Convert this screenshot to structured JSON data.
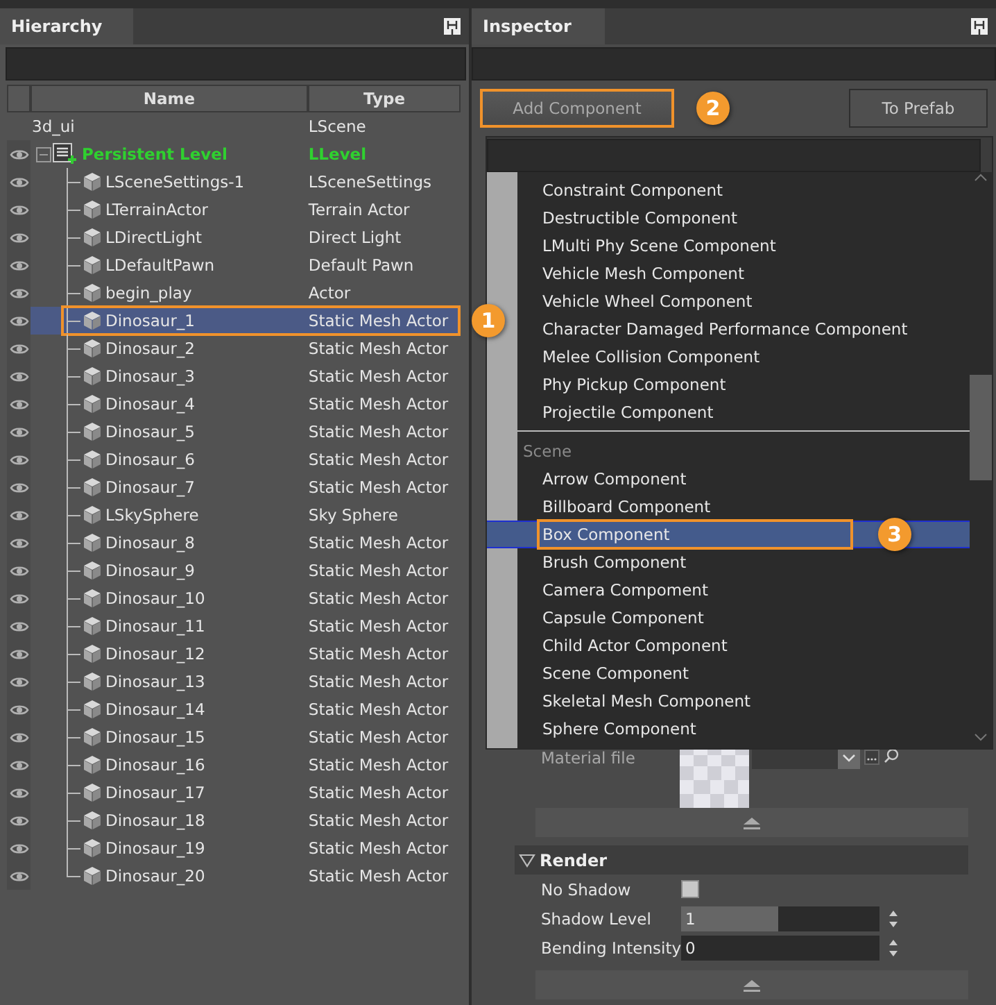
{
  "hierarchy": {
    "tab": "Hierarchy",
    "columns": [
      "Name",
      "Type"
    ],
    "root": {
      "name": "3d_ui",
      "type": "LScene",
      "selected": false,
      "children": [
        {
          "name": "Persistent Level",
          "type": "LLevel",
          "kind": "level",
          "visible": true,
          "expanded": true,
          "selected": false,
          "children": [
            {
              "name": "LSceneSettings-1",
              "type": "LSceneSettings",
              "kind": "actor",
              "visible": true,
              "selected": false
            },
            {
              "name": "LTerrainActor",
              "type": "Terrain Actor",
              "kind": "actor",
              "visible": true,
              "selected": false
            },
            {
              "name": "LDirectLight",
              "type": "Direct Light",
              "kind": "actor",
              "visible": true,
              "selected": false
            },
            {
              "name": "LDefaultPawn",
              "type": "Default Pawn",
              "kind": "actor",
              "visible": true,
              "selected": false
            },
            {
              "name": "begin_play",
              "type": "Actor",
              "kind": "actor",
              "visible": true,
              "selected": false
            },
            {
              "name": "Dinosaur_1",
              "type": "Static Mesh Actor",
              "kind": "actor",
              "visible": true,
              "selected": true,
              "callout": "1"
            },
            {
              "name": "Dinosaur_2",
              "type": "Static Mesh Actor",
              "kind": "actor",
              "visible": true,
              "selected": false
            },
            {
              "name": "Dinosaur_3",
              "type": "Static Mesh Actor",
              "kind": "actor",
              "visible": true,
              "selected": false
            },
            {
              "name": "Dinosaur_4",
              "type": "Static Mesh Actor",
              "kind": "actor",
              "visible": true,
              "selected": false
            },
            {
              "name": "Dinosaur_5",
              "type": "Static Mesh Actor",
              "kind": "actor",
              "visible": true,
              "selected": false
            },
            {
              "name": "Dinosaur_6",
              "type": "Static Mesh Actor",
              "kind": "actor",
              "visible": true,
              "selected": false
            },
            {
              "name": "Dinosaur_7",
              "type": "Static Mesh Actor",
              "kind": "actor",
              "visible": true,
              "selected": false
            },
            {
              "name": "LSkySphere",
              "type": "Sky Sphere",
              "kind": "actor",
              "visible": true,
              "selected": false
            },
            {
              "name": "Dinosaur_8",
              "type": "Static Mesh Actor",
              "kind": "actor",
              "visible": true,
              "selected": false
            },
            {
              "name": "Dinosaur_9",
              "type": "Static Mesh Actor",
              "kind": "actor",
              "visible": true,
              "selected": false
            },
            {
              "name": "Dinosaur_10",
              "type": "Static Mesh Actor",
              "kind": "actor",
              "visible": true,
              "selected": false
            },
            {
              "name": "Dinosaur_11",
              "type": "Static Mesh Actor",
              "kind": "actor",
              "visible": true,
              "selected": false
            },
            {
              "name": "Dinosaur_12",
              "type": "Static Mesh Actor",
              "kind": "actor",
              "visible": true,
              "selected": false
            },
            {
              "name": "Dinosaur_13",
              "type": "Static Mesh Actor",
              "kind": "actor",
              "visible": true,
              "selected": false
            },
            {
              "name": "Dinosaur_14",
              "type": "Static Mesh Actor",
              "kind": "actor",
              "visible": true,
              "selected": false
            },
            {
              "name": "Dinosaur_15",
              "type": "Static Mesh Actor",
              "kind": "actor",
              "visible": true,
              "selected": false
            },
            {
              "name": "Dinosaur_16",
              "type": "Static Mesh Actor",
              "kind": "actor",
              "visible": true,
              "selected": false
            },
            {
              "name": "Dinosaur_17",
              "type": "Static Mesh Actor",
              "kind": "actor",
              "visible": true,
              "selected": false
            },
            {
              "name": "Dinosaur_18",
              "type": "Static Mesh Actor",
              "kind": "actor",
              "visible": true,
              "selected": false
            },
            {
              "name": "Dinosaur_19",
              "type": "Static Mesh Actor",
              "kind": "actor",
              "visible": true,
              "selected": false
            },
            {
              "name": "Dinosaur_20",
              "type": "Static Mesh Actor",
              "kind": "actor",
              "visible": true,
              "selected": false
            }
          ]
        }
      ]
    }
  },
  "inspector": {
    "tab": "Inspector",
    "buttons": [
      {
        "label": "Add Component",
        "callout": "2"
      },
      {
        "label": "To Prefab"
      }
    ],
    "component_menu": {
      "groups": [
        {
          "items": [
            {
              "label": "Constraint Component",
              "selected": false
            },
            {
              "label": "Destructible Component",
              "selected": false
            },
            {
              "label": "LMulti Phy Scene Component",
              "selected": false
            },
            {
              "label": "Vehicle Mesh Component",
              "selected": false
            },
            {
              "label": "Vehicle Wheel Component",
              "selected": false
            },
            {
              "label": "Character Damaged Performance Component",
              "selected": false
            },
            {
              "label": "Melee Collision Component",
              "selected": false
            },
            {
              "label": "Phy Pickup Component",
              "selected": false
            },
            {
              "label": "Projectile Component",
              "selected": false
            }
          ]
        },
        {
          "title": "Scene",
          "items": [
            {
              "label": "Arrow Component",
              "selected": false
            },
            {
              "label": "Billboard Component",
              "selected": false
            },
            {
              "label": "Box Component",
              "selected": true,
              "callout": "3"
            },
            {
              "label": "Brush Component",
              "selected": false
            },
            {
              "label": "Camera Compoment",
              "selected": false
            },
            {
              "label": "Capsule Component",
              "selected": false
            },
            {
              "label": "Child Actor Component",
              "selected": false
            },
            {
              "label": "Scene Component",
              "selected": false
            },
            {
              "label": "Skeletal Mesh Component",
              "selected": false
            },
            {
              "label": "Sphere Component",
              "selected": false
            }
          ]
        }
      ]
    },
    "material": {
      "label": "Material file"
    },
    "render": {
      "title": "Render",
      "expanded": true,
      "fields": [
        {
          "kind": "checkbox",
          "label": "No Shadow",
          "checked": false
        },
        {
          "kind": "slider",
          "label": "Shadow Level",
          "value": "1",
          "level": 0.49
        },
        {
          "kind": "number",
          "label": "Bending Intensity",
          "value": "0"
        }
      ]
    }
  }
}
